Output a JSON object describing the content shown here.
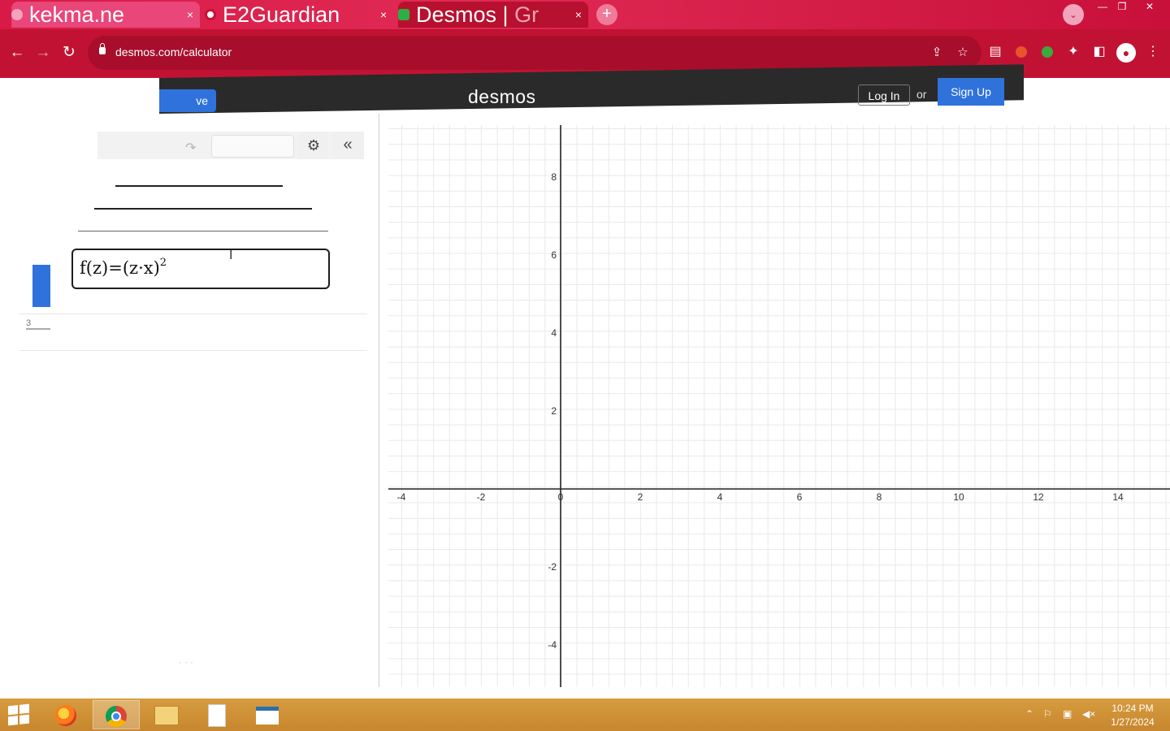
{
  "browser": {
    "tabs": [
      {
        "title": "kekma.ne",
        "close": "×"
      },
      {
        "title": "E2Guardian",
        "close": "×"
      },
      {
        "title": "Desmos",
        "title_sep": "|",
        "title_faded": "Gr",
        "close": "×"
      }
    ],
    "new_tab": "+",
    "tab_search": "⌄",
    "window_controls": {
      "minimize": "—",
      "maximize": "❐",
      "close": "✕"
    },
    "nav": {
      "back": "←",
      "forward": "→",
      "reload": "↻"
    },
    "url": "desmos.com/calculator",
    "omnibox_icons": {
      "share": "⇪",
      "bookmark": "☆"
    },
    "extensions": {
      "reader": "▤",
      "puzzle": "✦",
      "sidebar": "◧",
      "avatar": "●",
      "menu": "⋮"
    }
  },
  "desmos": {
    "header": {
      "logo": "desmos",
      "save_button": "ve",
      "login": "Log In",
      "or": "or",
      "signup": "Sign Up"
    },
    "expression_toolbar": {
      "undo": "↷",
      "settings": "⚙",
      "collapse": "«"
    },
    "expressions": [
      {
        "latex": "f(z)=(z·x)",
        "exponent": "2",
        "row_label": "3"
      }
    ],
    "graph": {
      "x_ticks": [
        "-4",
        "-2",
        "0",
        "2",
        "4",
        "6",
        "8",
        "10",
        "12",
        "14"
      ],
      "y_ticks": [
        "8",
        "6",
        "4",
        "2",
        "-2",
        "-4"
      ]
    }
  },
  "taskbar": {
    "clock_time": "10:24 PM",
    "clock_date": "1/27/2024",
    "tray": {
      "up": "⌃",
      "flag": "⚐",
      "network": "▣",
      "volume": "◀×"
    }
  },
  "colors": {
    "browser_tab_bar": "#d81a46",
    "browser_toolbar": "#c21233",
    "desmos_header": "#2a2a2a",
    "desmos_blue": "#2f72dc",
    "taskbar": "#d0913a"
  }
}
